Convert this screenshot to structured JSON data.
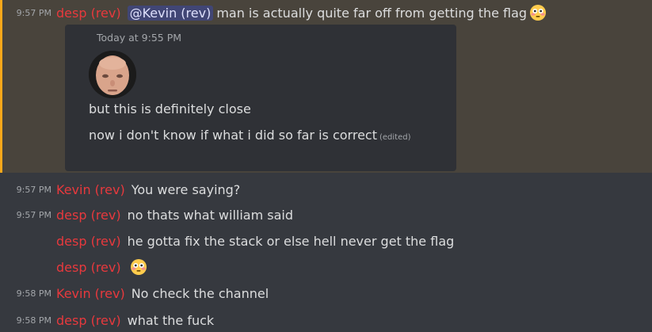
{
  "highlighted_message": {
    "time": "9:57 PM",
    "author": "desp (rev)",
    "mention": "@Kevin (rev)",
    "text": "man is actually quite far off from getting the flag",
    "emoji": "flushed-emoji"
  },
  "quoted_card": {
    "timestamp": "Today at 9:55 PM",
    "line1": "but this is definitely close",
    "line2": "now i don't know if what i did so far is correct",
    "edited_label": "(edited)"
  },
  "messages": [
    {
      "time": "9:57 PM",
      "author": "Kevin (rev)",
      "text": "You were saying?"
    },
    {
      "time": "9:57 PM",
      "author": "desp (rev)",
      "text": "no thats what william said"
    },
    {
      "time": "",
      "author": "desp (rev)",
      "text": "he gotta fix the stack or else hell never get the flag"
    },
    {
      "time": "",
      "author": "desp (rev)",
      "text": "",
      "emoji": "flushed-emoji"
    },
    {
      "time": "9:58 PM",
      "author": "Kevin (rev)",
      "text": "No check the channel"
    },
    {
      "time": "9:58 PM",
      "author": "desp (rev)",
      "text": "what the fuck"
    }
  ],
  "colors": {
    "background": "#36393f",
    "highlight_background": "#49443c",
    "author_red": "#e8393d",
    "mention_bg": "#414675"
  }
}
